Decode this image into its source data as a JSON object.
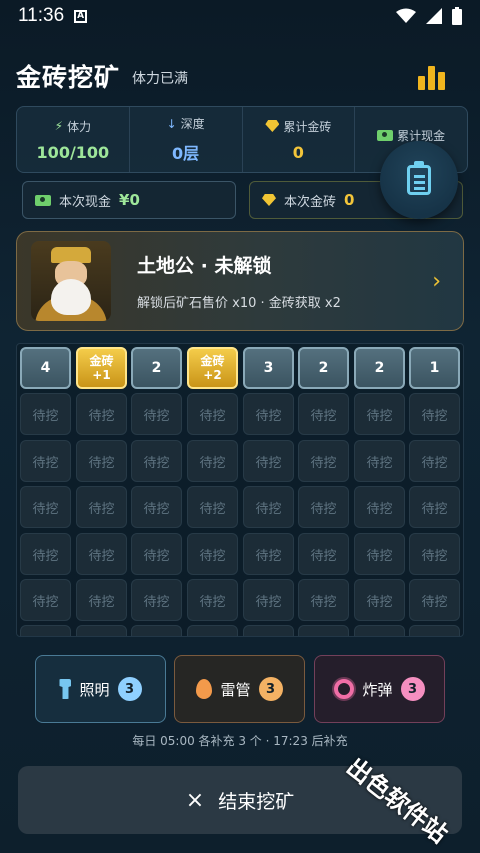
{
  "status_bar": {
    "time": "11:36",
    "notif_letter": "A"
  },
  "header": {
    "title": "金砖挖矿",
    "subtitle": "体力已满"
  },
  "stats": [
    {
      "label": "体力",
      "value": "100/100"
    },
    {
      "label": "深度",
      "value": "0层"
    },
    {
      "label": "累计金砖",
      "value": "0"
    },
    {
      "label": "累计现金",
      "value": ""
    }
  ],
  "session": {
    "cash_label": "本次现金",
    "cash_value": "¥0",
    "gold_label": "本次金砖",
    "gold_value": "0"
  },
  "god_card": {
    "name": "土地公 · 未解锁",
    "description": "解锁后矿石售价 x10 · 金砖获取 x2"
  },
  "grid": {
    "top_row": [
      {
        "type": "num",
        "text": "4"
      },
      {
        "type": "gold",
        "text": "金砖",
        "sub": "+1"
      },
      {
        "type": "num",
        "text": "2"
      },
      {
        "type": "gold",
        "text": "金砖",
        "sub": "+2"
      },
      {
        "type": "num",
        "text": "3"
      },
      {
        "type": "num",
        "text": "2"
      },
      {
        "type": "num",
        "text": "2"
      },
      {
        "type": "num",
        "text": "1"
      }
    ],
    "pending_label": "待挖"
  },
  "tools": {
    "light_label": "照明",
    "light_count": "3",
    "tube_label": "雷管",
    "tube_count": "3",
    "bomb_label": "炸弹",
    "bomb_count": "3"
  },
  "refill_text": "每日 05:00 各补充 3 个 · 17:23 后补充",
  "end_button": {
    "icon": "×",
    "label": "结束挖矿"
  },
  "watermark": "出色软件站",
  "colors": {
    "gold": "#f3c53a",
    "green": "#9ee69a",
    "blue": "#7fb8ff"
  }
}
